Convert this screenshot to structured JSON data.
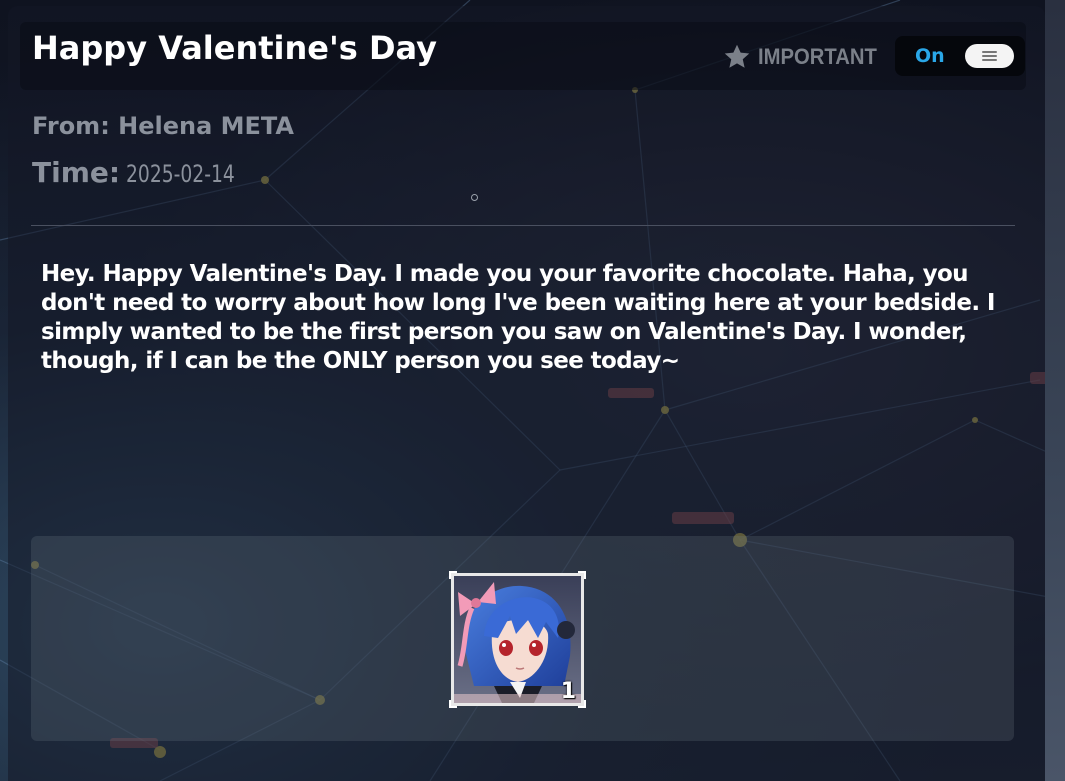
{
  "mail": {
    "title": "Happy Valentine's Day",
    "important_label": "IMPORTANT",
    "important_icon": "star-icon",
    "toggle_label": "On",
    "from": "From: Helena META",
    "time_label": "Time:",
    "time_value": "2025-02-14",
    "body": "Hey. Happy Valentine's Day. I made you your favorite chocolate. Haha, you don't need to worry about how long I've been waiting here at your bedside. I simply wanted to be the first person you saw on Valentine's Day. I wonder, though, if I can be the ONLY person you see today~",
    "attachments": [
      {
        "icon": "character-portrait-icon",
        "count": "1"
      }
    ]
  },
  "colors": {
    "toggle_on": "#2aa7e8",
    "meta_text": "#8b919c",
    "important_text": "#7b8089",
    "body_text": "#ffffff"
  }
}
